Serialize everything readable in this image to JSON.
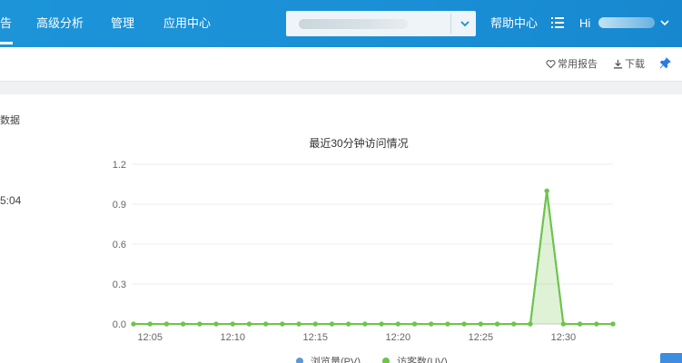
{
  "nav": {
    "items": [
      {
        "label": "告"
      },
      {
        "label": "高级分析"
      },
      {
        "label": "管理"
      },
      {
        "label": "应用中心"
      }
    ],
    "help_label": "帮助中心",
    "user_greeting": "Hi"
  },
  "toolbar": {
    "favorites_label": "常用报告",
    "download_label": "下载"
  },
  "panel": {
    "left_caption": "数据",
    "left_time": "5:04"
  },
  "chart_data": {
    "type": "area",
    "title": "最近30分钟访问情况",
    "x": [
      "12:04",
      "12:05",
      "12:06",
      "12:07",
      "12:08",
      "12:09",
      "12:10",
      "12:11",
      "12:12",
      "12:13",
      "12:14",
      "12:15",
      "12:16",
      "12:17",
      "12:18",
      "12:19",
      "12:20",
      "12:21",
      "12:22",
      "12:23",
      "12:24",
      "12:25",
      "12:26",
      "12:27",
      "12:28",
      "12:29",
      "12:30",
      "12:31",
      "12:32",
      "12:33"
    ],
    "xticks": [
      "12:05",
      "12:10",
      "12:15",
      "12:20",
      "12:25",
      "12:30"
    ],
    "yticks": [
      "0.0",
      "0.3",
      "0.6",
      "0.9",
      "1.2"
    ],
    "ylim": [
      0,
      1.2
    ],
    "grid": true,
    "legend_position": "bottom",
    "series": [
      {
        "name": "浏览量(PV)",
        "color": "#5b9bd5",
        "values": [
          0,
          0,
          0,
          0,
          0,
          0,
          0,
          0,
          0,
          0,
          0,
          0,
          0,
          0,
          0,
          0,
          0,
          0,
          0,
          0,
          0,
          0,
          0,
          0,
          0,
          1,
          0,
          0,
          0,
          0
        ]
      },
      {
        "name": "访客数(UV)",
        "color": "#6cc644",
        "values": [
          0,
          0,
          0,
          0,
          0,
          0,
          0,
          0,
          0,
          0,
          0,
          0,
          0,
          0,
          0,
          0,
          0,
          0,
          0,
          0,
          0,
          0,
          0,
          0,
          0,
          1,
          0,
          0,
          0,
          0
        ]
      }
    ]
  }
}
